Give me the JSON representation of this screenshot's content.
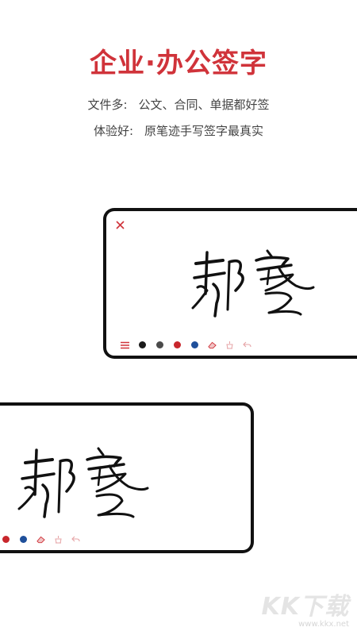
{
  "headline": "企业·办公签字",
  "features": [
    {
      "label": "文件多:",
      "text": "公文、合同、单据都好签"
    },
    {
      "label": "体验好:",
      "text": "原笔迹手写签字最真实"
    }
  ],
  "colors": {
    "accent": "#d0333a",
    "ink_black": "#1a1a1a",
    "ink_gray": "#4a4a4a",
    "ink_red": "#c8262c",
    "ink_blue": "#1f4f9a",
    "tool_faint": "#e6a3a5"
  },
  "card_top": {
    "close_icon": "close-icon",
    "toolbar": [
      "menu-icon",
      "black-ink-dot",
      "gray-ink-dot",
      "red-ink-dot",
      "blue-ink-dot",
      "eraser-icon",
      "clear-icon",
      "undo-icon"
    ]
  },
  "card_bottom": {
    "toolbar": [
      "red-ink-dot",
      "blue-ink-dot",
      "eraser-icon",
      "clear-icon",
      "undo-icon"
    ]
  },
  "watermark": {
    "main": "KK下载",
    "url": "www.kkx.net"
  }
}
